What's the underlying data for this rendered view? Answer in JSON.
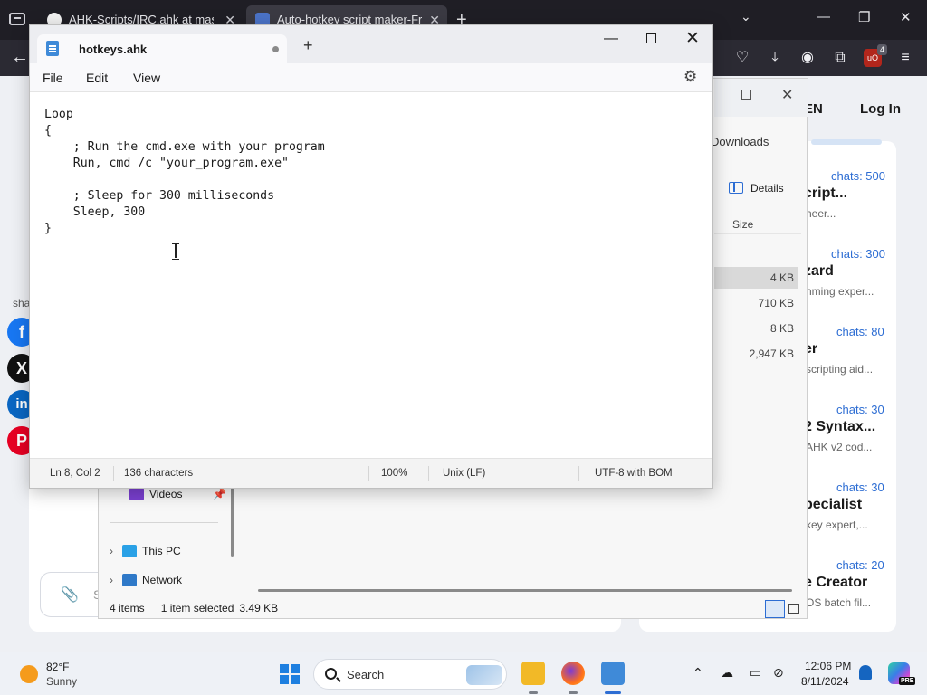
{
  "browser": {
    "tabs": [
      {
        "label": "AHK-Scripts/IRC.ahk at master"
      },
      {
        "label": "Auto-hotkey script maker-Free"
      }
    ]
  },
  "webpage": {
    "login_partial": "EN",
    "login_label": "Log In",
    "share_label": "sha",
    "chat_placeholder": "S",
    "cards": [
      {
        "chats": "chats: 500",
        "title": "cript...",
        "desc": "neer..."
      },
      {
        "chats": "chats: 300",
        "title": "zard",
        "desc": "nming exper..."
      },
      {
        "chats": "chats: 80",
        "title": "er",
        "desc": "scripting aid..."
      },
      {
        "chats": "chats: 30",
        "title": "2 Syntax...",
        "desc": "AHK v2 cod..."
      },
      {
        "chats": "chats: 30",
        "title": "pecialist",
        "desc": "key expert,..."
      },
      {
        "chats": "chats: 20",
        "title": "e Creator",
        "desc": "OS batch fil..."
      }
    ]
  },
  "explorer": {
    "breadcrumb": "Downloads",
    "details_label": "Details",
    "size_header": "Size",
    "sizes": [
      "4 KB",
      "710 KB",
      "8 KB",
      "2,947 KB"
    ],
    "nav": {
      "videos": "Videos",
      "this_pc": "This PC",
      "network": "Network"
    },
    "status": {
      "items": "4 items",
      "selected": "1 item selected",
      "size": "3.49 KB"
    }
  },
  "notepad": {
    "tab_title": "hotkeys.ahk",
    "menu": {
      "file": "File",
      "edit": "Edit",
      "view": "View"
    },
    "content": "Loop\n{\n    ; Run the cmd.exe with your program\n    Run, cmd /c \"your_program.exe\"\n\n    ; Sleep for 300 milliseconds\n    Sleep, 300\n}",
    "status": {
      "position": "Ln 8, Col 2",
      "characters": "136 characters",
      "zoom": "100%",
      "line_ending": "Unix (LF)",
      "encoding": "UTF-8 with BOM"
    }
  },
  "taskbar": {
    "weather_temp": "82°F",
    "weather_cond": "Sunny",
    "search_label": "Search",
    "time": "12:06 PM",
    "date": "8/11/2024",
    "copilot_badge": "PRE"
  },
  "colors": {
    "accent": "#2d6dd3",
    "browser_dark": "#1f1e25",
    "facebook": "#1877f2",
    "x": "#111111",
    "linkedin": "#0a66c2",
    "pinterest": "#e60023"
  },
  "icons": {
    "extension_badge_count": "4"
  }
}
